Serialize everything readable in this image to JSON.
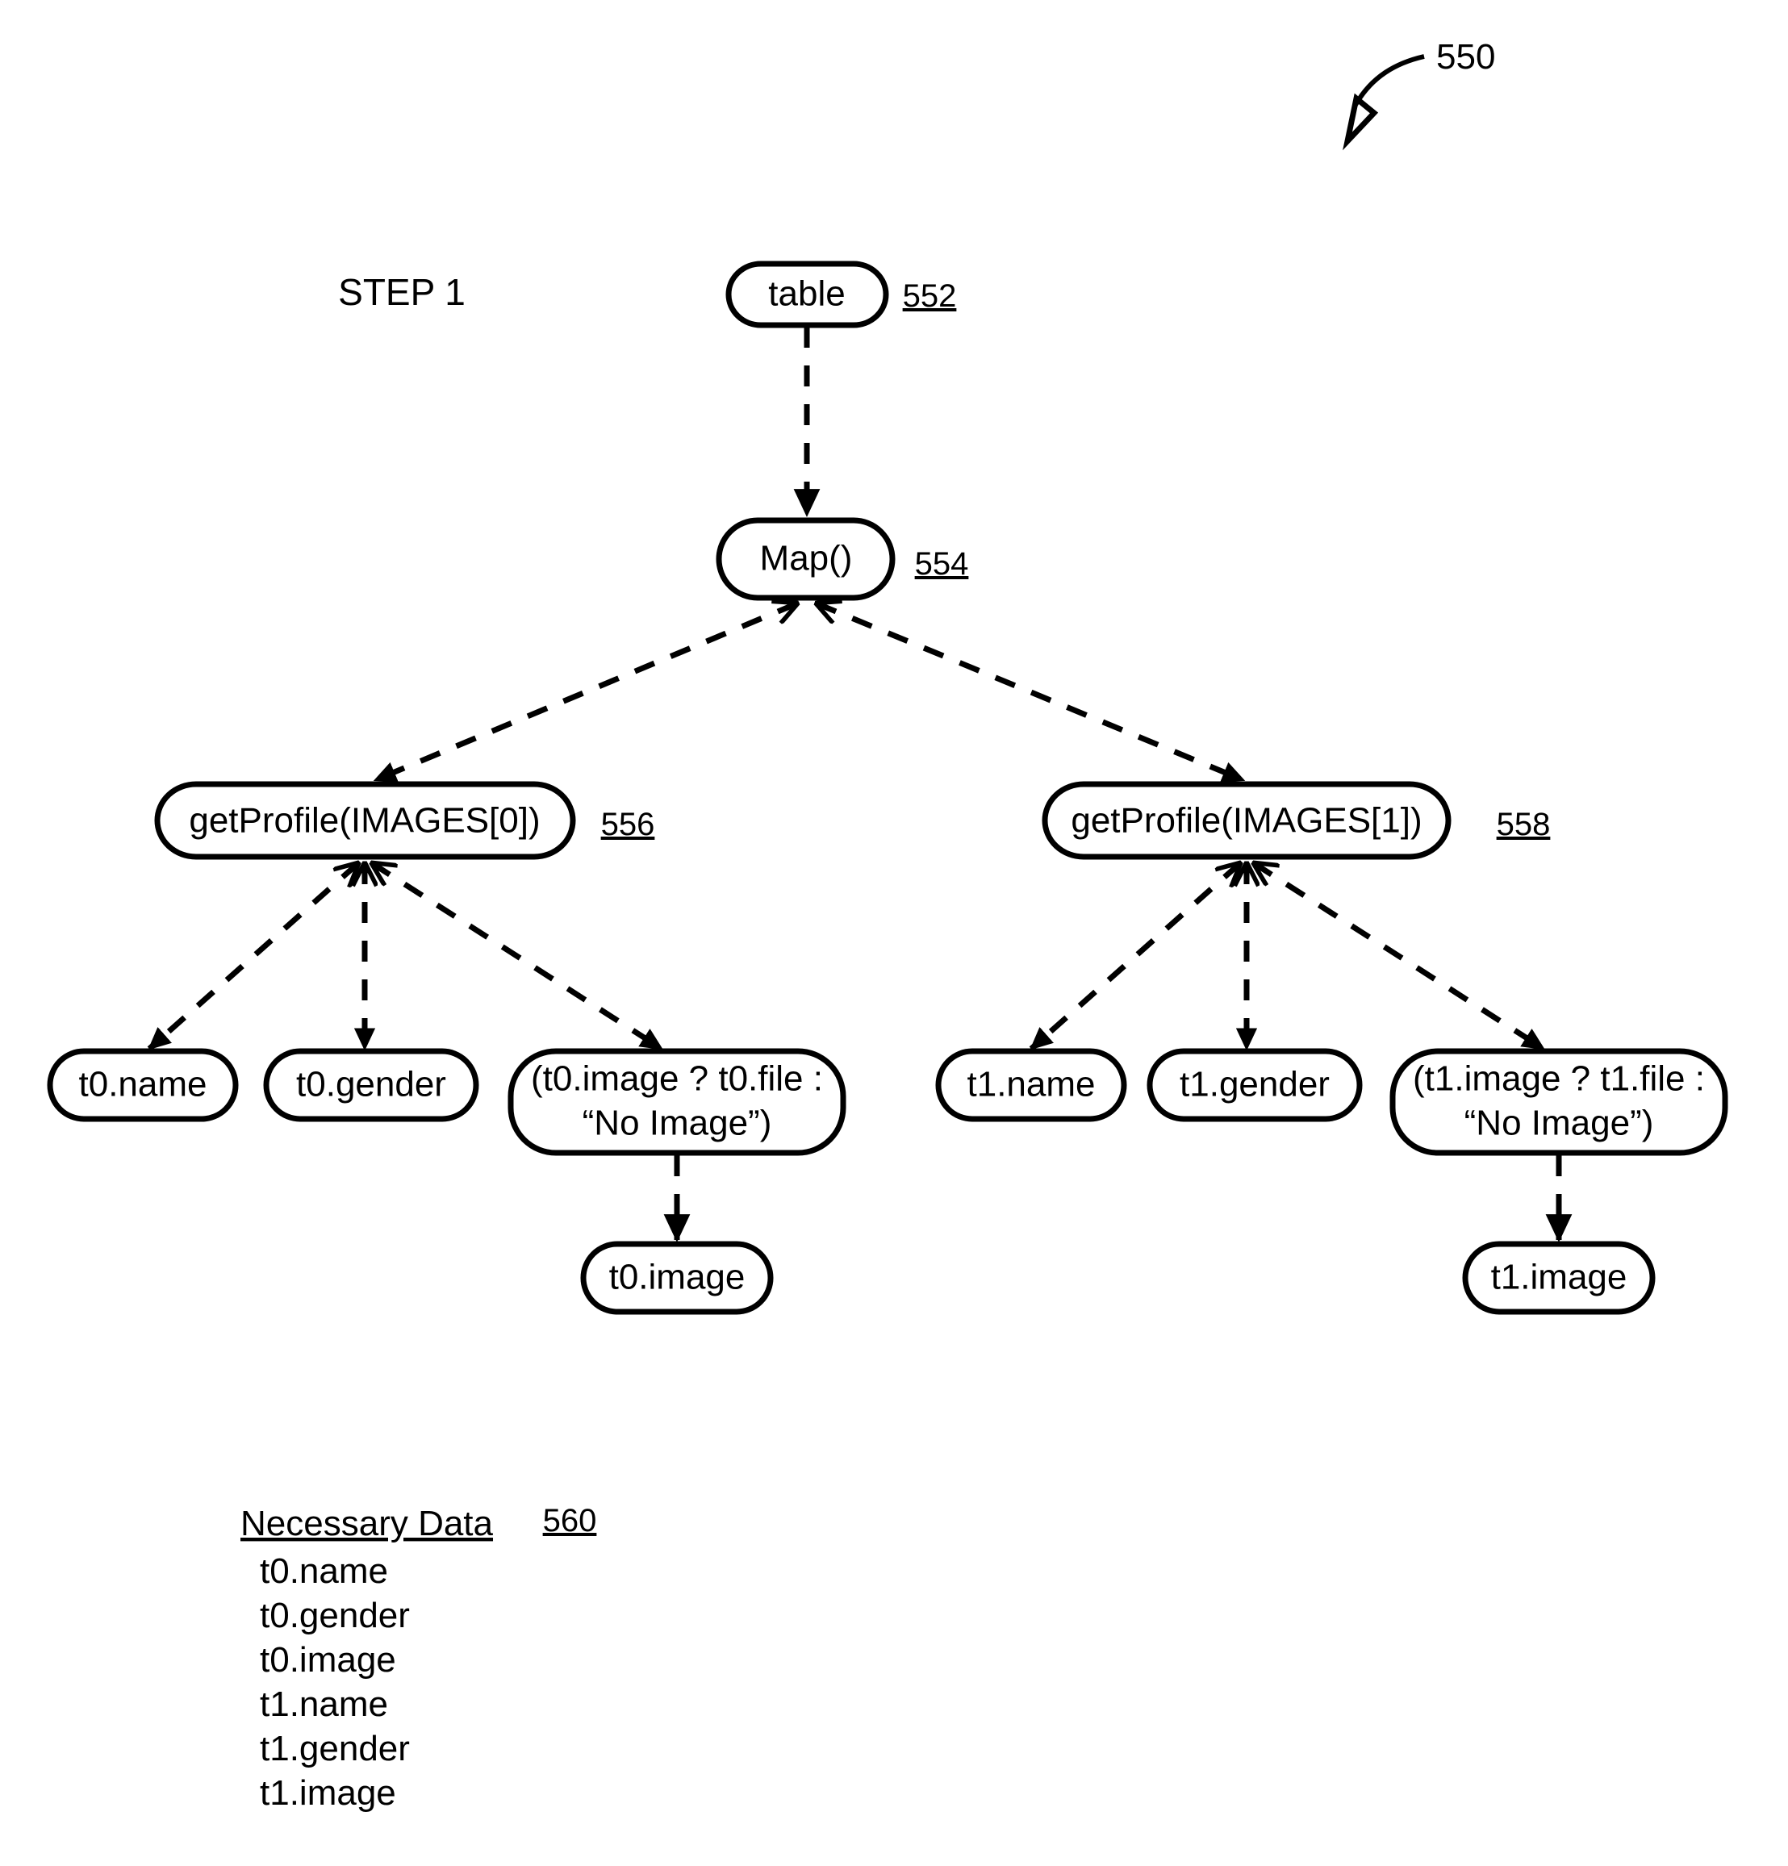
{
  "figure": {
    "reference_numeral": "550",
    "step_label": "STEP 1"
  },
  "nodes": {
    "table": {
      "label": "table",
      "ref": "552"
    },
    "map": {
      "label": "Map()",
      "ref": "554"
    },
    "get_profile_0": {
      "label": "getProfile(IMAGES[0])",
      "ref": "556"
    },
    "get_profile_1": {
      "label": "getProfile(IMAGES[1])",
      "ref": "558"
    },
    "t0_name": {
      "label": "t0.name"
    },
    "t0_gender": {
      "label": "t0.gender"
    },
    "t0_ternary": {
      "line1": "(t0.image ? t0.file :",
      "line2": "“No Image”)"
    },
    "t0_image": {
      "label": "t0.image"
    },
    "t1_name": {
      "label": "t1.name"
    },
    "t1_gender": {
      "label": "t1.gender"
    },
    "t1_ternary": {
      "line1": "(t1.image ? t1.file :",
      "line2": "“No Image”)"
    },
    "t1_image": {
      "label": "t1.image"
    }
  },
  "necessary_data": {
    "heading": "Necessary Data",
    "ref": "560",
    "items": [
      "t0.name",
      "t0.gender",
      "t0.image",
      "t1.name",
      "t1.gender",
      "t1.image"
    ]
  },
  "colors": {
    "stroke": "#000000",
    "background": "#ffffff"
  }
}
